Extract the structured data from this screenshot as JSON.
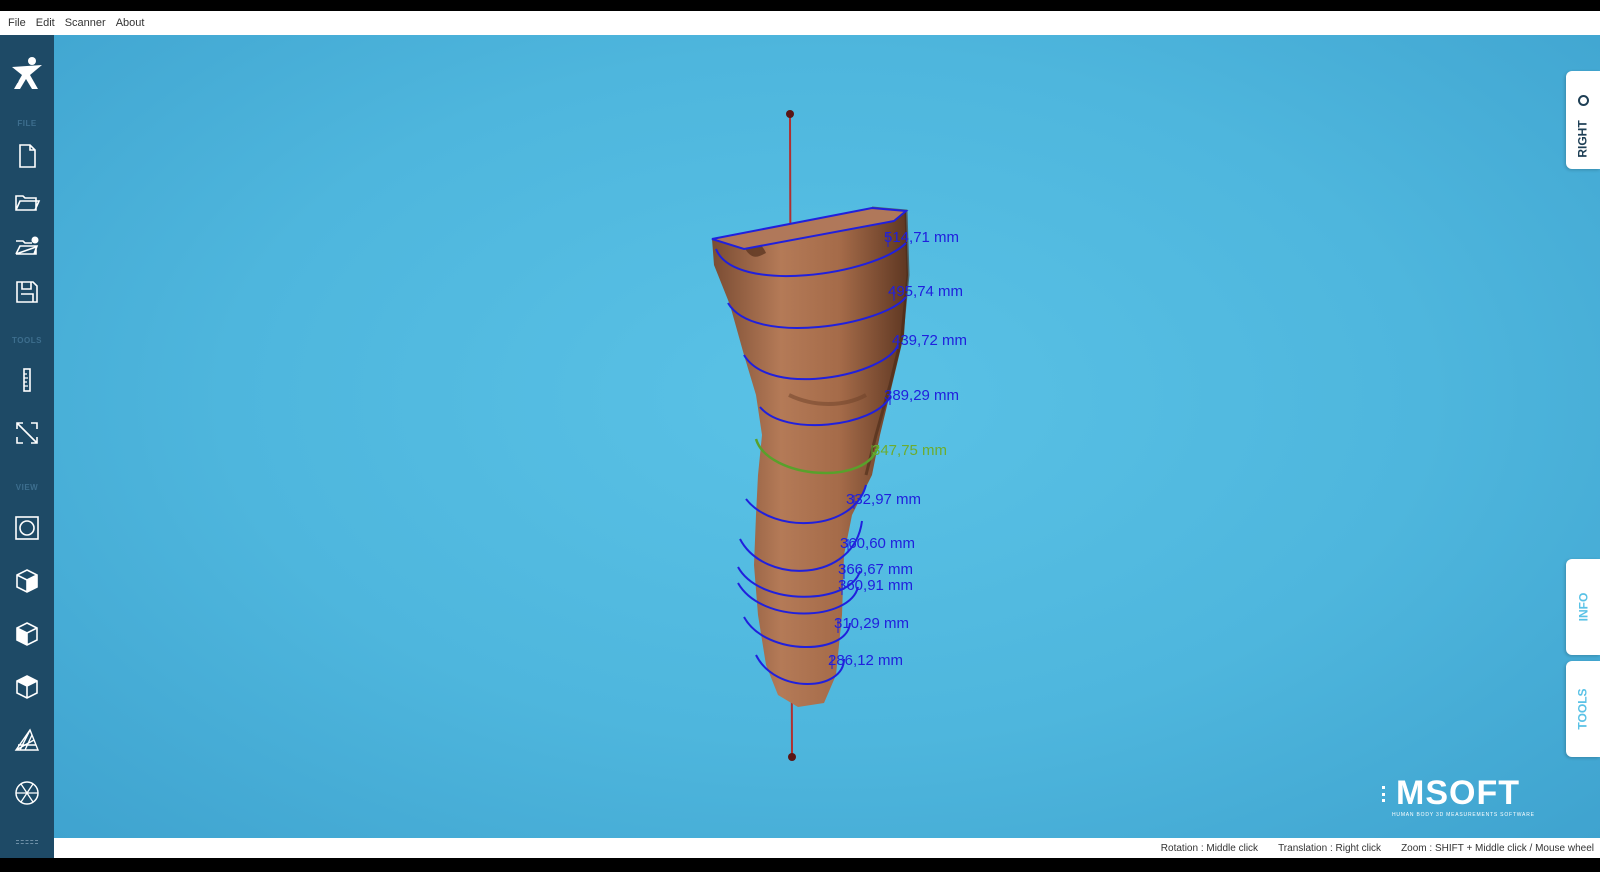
{
  "menu": {
    "file": "File",
    "edit": "Edit",
    "scanner": "Scanner",
    "about": "About"
  },
  "sidebar": {
    "sections": {
      "file": "FILE",
      "tools": "TOOLS",
      "view": "VIEW"
    },
    "file_tools": [
      "new-file-icon",
      "open-folder-icon",
      "open-recent-folder-icon",
      "save-icon"
    ],
    "tools": [
      "ruler-icon",
      "scale-arrows-icon"
    ],
    "view": [
      "view-front-icon",
      "view-cube-icon",
      "view-cube-side-icon",
      "view-cube-top-icon",
      "mesh-icon",
      "wireframe-icon"
    ]
  },
  "measurements": [
    "514,71 mm",
    "495,74 mm",
    "439,72 mm",
    "389,29 mm",
    "347,75 mm",
    "332,97 mm",
    "360,60 mm",
    "366,67 mm",
    "360,91 mm",
    "310,29 mm",
    "286,12 mm"
  ],
  "active_measurement_index": 4,
  "colors": {
    "ring": "#2020dd",
    "active_ring": "#6dac2e",
    "background": "#4eb6dd",
    "sidebar": "#1e4a66",
    "skin": "#a36b4a"
  },
  "tabs": {
    "right": "RIGHT",
    "info": "INFO",
    "tools": "TOOLS"
  },
  "brand": {
    "name": "MSOFT",
    "tagline": "HUMAN BODY 3D MEASUREMENTS SOFTWARE"
  },
  "status": {
    "rotation": "Rotation : Middle click",
    "translation": "Translation : Right click",
    "zoom": "Zoom : SHIFT + Middle click / Mouse wheel"
  }
}
